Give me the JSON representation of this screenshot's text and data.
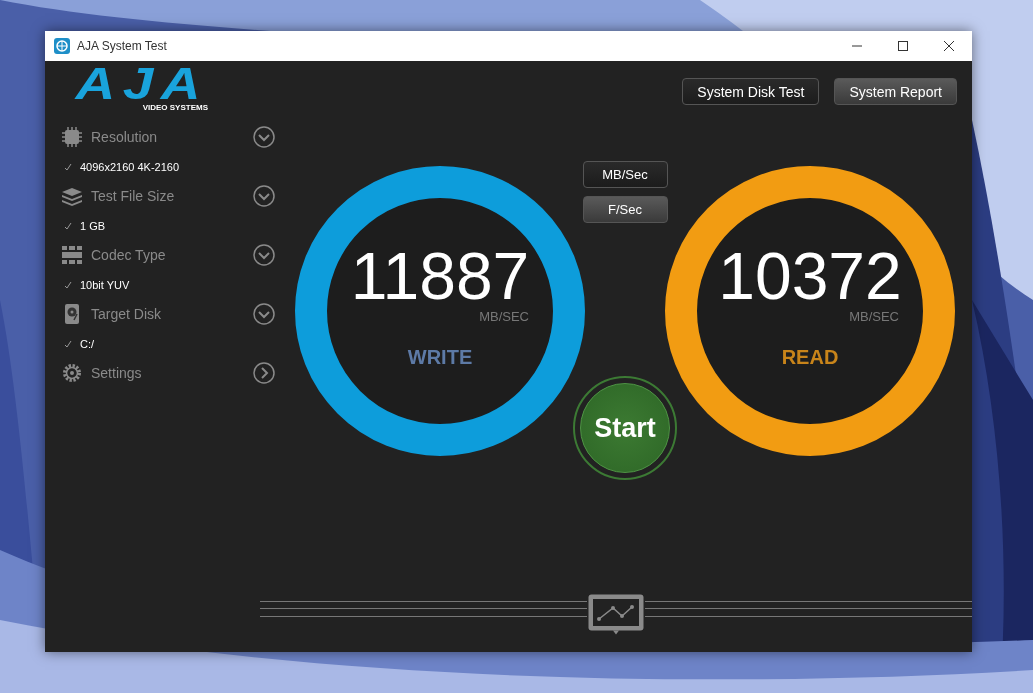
{
  "window": {
    "title": "AJA System Test"
  },
  "logo": {
    "mark": "AJA",
    "subtitle": "VIDEO SYSTEMS"
  },
  "sidebar": {
    "items": [
      {
        "kind": "dropdown",
        "label": "Resolution",
        "value": "4096x2160 4K-2160"
      },
      {
        "kind": "dropdown",
        "label": "Test File Size",
        "value": "1 GB"
      },
      {
        "kind": "dropdown",
        "label": "Codec Type",
        "value": "10bit YUV"
      },
      {
        "kind": "dropdown",
        "label": "Target Disk",
        "value": "C:/"
      },
      {
        "kind": "submenu",
        "label": "Settings"
      }
    ]
  },
  "top_buttons": [
    "System Disk Test",
    "System Report"
  ],
  "unit_buttons": [
    {
      "label": "MB/Sec",
      "selected": true
    },
    {
      "label": "F/Sec",
      "selected": false
    }
  ],
  "gauges": [
    {
      "value": "11887",
      "unit": "MB/SEC",
      "label": "WRITE",
      "color": "#0d9ddb"
    },
    {
      "value": "10372",
      "unit": "MB/SEC",
      "label": "READ",
      "color": "#f29c12"
    }
  ],
  "start_button": "Start"
}
